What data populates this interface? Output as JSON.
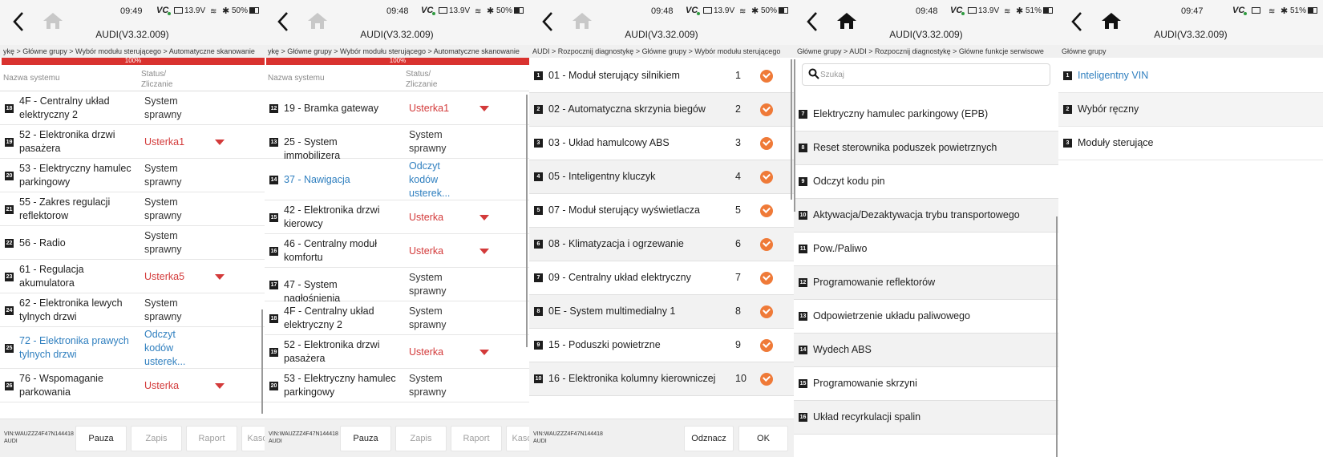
{
  "colors": {
    "accent": "#d33a3a",
    "link": "#2f7fbf",
    "check": "#ef7a38"
  },
  "icons": {
    "back": "chevron-left-icon",
    "home": "home-icon",
    "check": "check-circle-icon",
    "search": "search-icon"
  },
  "status": {
    "vci": "VC",
    "voltage": "13.9V"
  },
  "app_title": "AUDI(V3.32.009)",
  "panels": [
    {
      "time": "09:49",
      "battery": "50%",
      "breadcrumb": "ykę > Główne grupy > Wybór modułu sterującego > Automatyczne skanowanie",
      "progress": "100%",
      "col_name": "Nazwa systemu",
      "col_status": "Status/ Zliczanie",
      "partial_top": "sprawny",
      "rows": [
        {
          "num": "18",
          "name": "4F - Centralny układ elektryczny 2",
          "status": "System sprawny"
        },
        {
          "num": "19",
          "name": "52 - Elektronika drzwi pasażera",
          "status": "Usterka1"
        },
        {
          "num": "20",
          "name": "53 - Elektryczny hamulec parkingowy",
          "status": "System sprawny"
        },
        {
          "num": "21",
          "name": "55 - Zakres regulacji reflektorow",
          "status": "System sprawny"
        },
        {
          "num": "22",
          "name": "56 - Radio",
          "status": "System sprawny"
        },
        {
          "num": "23",
          "name": "61 - Regulacja akumulatora",
          "status": "Usterka5"
        },
        {
          "num": "24",
          "name": "62 - Elektronika lewych tylnych drzwi",
          "status": "System sprawny"
        },
        {
          "num": "25",
          "name": "72 - Elektronika prawych tylnych drzwi",
          "status": "Odczyt kodów usterek..."
        },
        {
          "num": "26",
          "name": "76 - Wspomaganie parkowania",
          "status": "Usterka"
        }
      ],
      "vin_line1": "VIN:WAUZZZ4F47N144418",
      "vin_line2": "AUDI",
      "buttons": [
        "Pauza",
        "Zapis",
        "Raport",
        "Kaso"
      ]
    },
    {
      "time": "09:48",
      "battery": "50%",
      "breadcrumb": "ykę > Główne grupy > Wybór modułu sterującego > Automatyczne skanowanie",
      "progress": "100%",
      "col_name": "Nazwa systemu",
      "col_status": "Status/ Zliczanie",
      "rows": [
        {
          "num": "12",
          "name": "19 - Bramka gateway",
          "status": "Usterka1"
        },
        {
          "num": "13",
          "name": "25 - System immobilizera",
          "status": "System sprawny"
        },
        {
          "num": "14",
          "name": "37 - Nawigacja",
          "status": "Odczyt kodów usterek..."
        },
        {
          "num": "15",
          "name": "42 - Elektronika drzwi kierowcy",
          "status": "Usterka"
        },
        {
          "num": "16",
          "name": "46 - Centralny moduł komfortu",
          "status": "Usterka"
        },
        {
          "num": "17",
          "name": "47 - System nagłośnienia",
          "status": "System sprawny"
        },
        {
          "num": "18",
          "name": "4F - Centralny układ elektryczny 2",
          "status": "System sprawny"
        },
        {
          "num": "19",
          "name": "52 - Elektronika drzwi pasażera",
          "status": "Usterka"
        },
        {
          "num": "20",
          "name": "53 - Elektryczny hamulec parkingowy",
          "status": "System sprawny"
        }
      ],
      "vin_line1": "VIN:WAUZZZ4F47N144418",
      "vin_line2": "AUDI",
      "buttons": [
        "Pauza",
        "Zapis",
        "Raport",
        "Kaso"
      ]
    },
    {
      "time": "09:48",
      "battery": "50%",
      "breadcrumb": "AUDI > Rozpocznij diagnostykę > Główne grupy > Wybór modułu sterującego",
      "rows": [
        {
          "num": "1",
          "name": "01 - Moduł sterujący silnikiem",
          "count": "1"
        },
        {
          "num": "2",
          "name": "02 - Automatyczna skrzynia biegów",
          "count": "2"
        },
        {
          "num": "3",
          "name": "03 - Układ hamulcowy ABS",
          "count": "3"
        },
        {
          "num": "4",
          "name": "05 - Inteligentny kluczyk",
          "count": "4"
        },
        {
          "num": "5",
          "name": "07 - Moduł sterujący wyświetlacza",
          "count": "5"
        },
        {
          "num": "6",
          "name": "08 - Klimatyzacja i ogrzewanie",
          "count": "6"
        },
        {
          "num": "7",
          "name": "09 - Centralny układ elektryczny",
          "count": "7"
        },
        {
          "num": "8",
          "name": "0E - System multimedialny 1",
          "count": "8"
        },
        {
          "num": "9",
          "name": "15 - Poduszki powietrzne",
          "count": "9"
        },
        {
          "num": "10",
          "name": "16 - Elektronika kolumny kierowniczej",
          "count": "10"
        }
      ],
      "vin_line1": "VIN:WAUZZZ4F47N144418",
      "vin_line2": "AUDI",
      "buttons": [
        "Odznacz",
        "OK"
      ]
    },
    {
      "time": "09:48",
      "battery": "51%",
      "breadcrumb": "Główne grupy > AUDI > Rozpocznij diagnostykę > Główne funkcje serwisowe",
      "search_placeholder": "Szukaj",
      "rows": [
        {
          "num": "7",
          "name": "Elektryczny hamulec parkingowy (EPB)"
        },
        {
          "num": "8",
          "name": "Reset sterownika poduszek powietrznych"
        },
        {
          "num": "9",
          "name": "Odczyt kodu pin"
        },
        {
          "num": "10",
          "name": "Aktywacja/Dezaktywacja trybu transportowego"
        },
        {
          "num": "11",
          "name": "Pow./Paliwo"
        },
        {
          "num": "12",
          "name": "Programowanie reflektorów"
        },
        {
          "num": "13",
          "name": "Odpowietrzenie układu paliwowego"
        },
        {
          "num": "14",
          "name": "Wydech ABS"
        },
        {
          "num": "15",
          "name": "Programowanie skrzyni"
        },
        {
          "num": "16",
          "name": "Układ recyrkulacji spalin"
        }
      ]
    },
    {
      "time": "09:47",
      "battery": "51%",
      "breadcrumb": "Główne grupy",
      "rows": [
        {
          "num": "1",
          "name": "Inteligentny VIN"
        },
        {
          "num": "2",
          "name": "Wybór ręczny"
        },
        {
          "num": "3",
          "name": "Moduły sterujące"
        }
      ]
    }
  ]
}
